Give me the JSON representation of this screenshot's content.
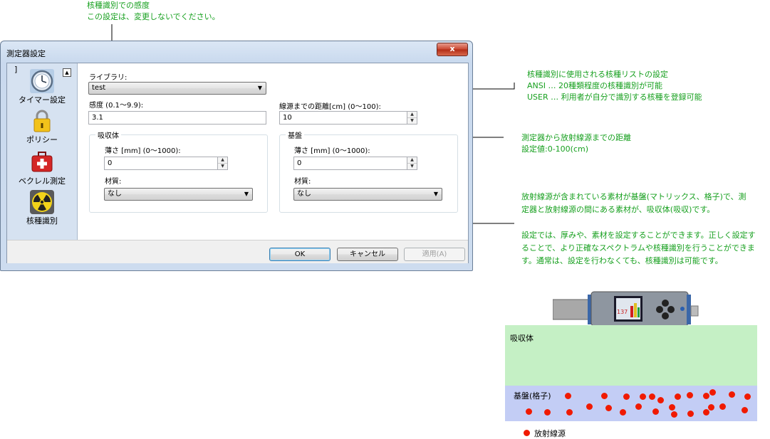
{
  "annotations": {
    "sensitivity_note": "核種識別での感度\nこの設定は、変更しないでください。",
    "library_note": "核種識別に使用される核種リストの設定\nANSI … 20種類程度の核種識別が可能\nUSER … 利用者が自分で識別する核種を登録可能",
    "distance_note": "測定器から放射線源までの距離\n設定値:0-100(cm)",
    "material_note": "放射線源が含まれている素材が基盤(マトリックス、格子)で、測\n定器と放射線源の間にある素材が、吸収体(吸収)です。\n\n設定では、厚みや、素材を設定することができます。正しく設定す\nることで、より正確なスペクトラムや核種識別を行うことができま\nす。通常は、設定を行わなくても、核種識別は可能です。"
  },
  "window": {
    "title": "測定器設定",
    "close_label": "x"
  },
  "sidebar": {
    "bracket": "]",
    "collapse": "▲",
    "items": [
      {
        "label": "タイマー設定",
        "icon": "clock-icon"
      },
      {
        "label": "ポリシー",
        "icon": "lock-icon"
      },
      {
        "label": "ベクレル測定",
        "icon": "first-aid-kit-icon"
      },
      {
        "label": "核種識別",
        "icon": "radiation-icon"
      }
    ]
  },
  "form": {
    "library_label": "ライブラリ:",
    "library_value": "test",
    "sensitivity_label": "感度 (0.1〜9.9):",
    "sensitivity_value": "3.1",
    "distance_label": "線源までの距離[cm] (0〜100):",
    "distance_value": "10",
    "absorber": {
      "title": "吸収体",
      "thickness_label": "薄さ [mm] (0〜1000):",
      "thickness_value": "0",
      "material_label": "材質:",
      "material_value": "なし"
    },
    "substrate": {
      "title": "基盤",
      "thickness_label": "薄さ [mm] (0〜1000):",
      "thickness_value": "0",
      "material_label": "材質:",
      "material_value": "なし"
    }
  },
  "buttons": {
    "ok": "OK",
    "cancel": "キャンセル",
    "apply": "適用(A)"
  },
  "illustration": {
    "absorber_label": "吸収体",
    "substrate_label": "基盤(格子)",
    "legend_label": "放射線源",
    "device_reading": "137",
    "colors": {
      "absorber": "#c5f0c5",
      "substrate": "#c3cdf5",
      "source": "#f01a00",
      "annotation": "#17a01f"
    }
  }
}
